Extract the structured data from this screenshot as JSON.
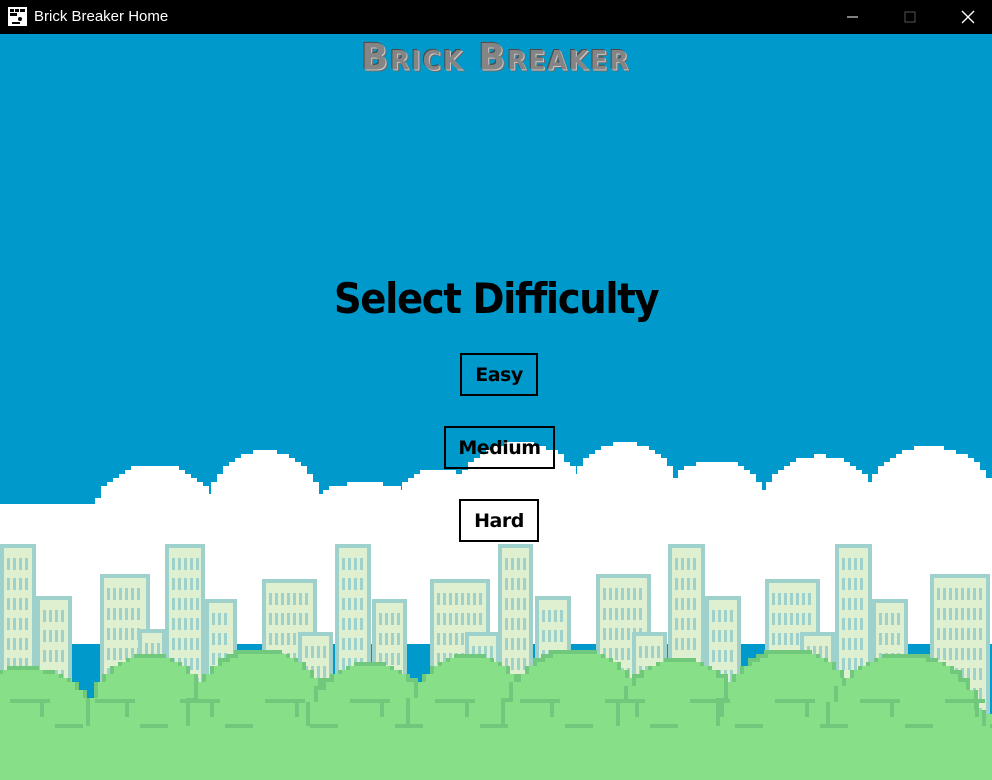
{
  "window": {
    "title": "Brick Breaker Home",
    "icon": "brick-breaker-app-icon",
    "controls": [
      "minimize-icon",
      "maximize-icon",
      "close-icon"
    ]
  },
  "game": {
    "logo": "Brick Breaker",
    "heading": "Select Difficulty",
    "difficulties": [
      "Easy",
      "Medium",
      "Hard"
    ]
  },
  "colors": {
    "sky": "#0099cc",
    "clouds": "#ffffff",
    "buildings": "#dff0d0",
    "building_outline": "#9ed0cc",
    "bushes": "#87e087",
    "bush_shadow": "#6fc87c",
    "titlebar": "#000000"
  }
}
